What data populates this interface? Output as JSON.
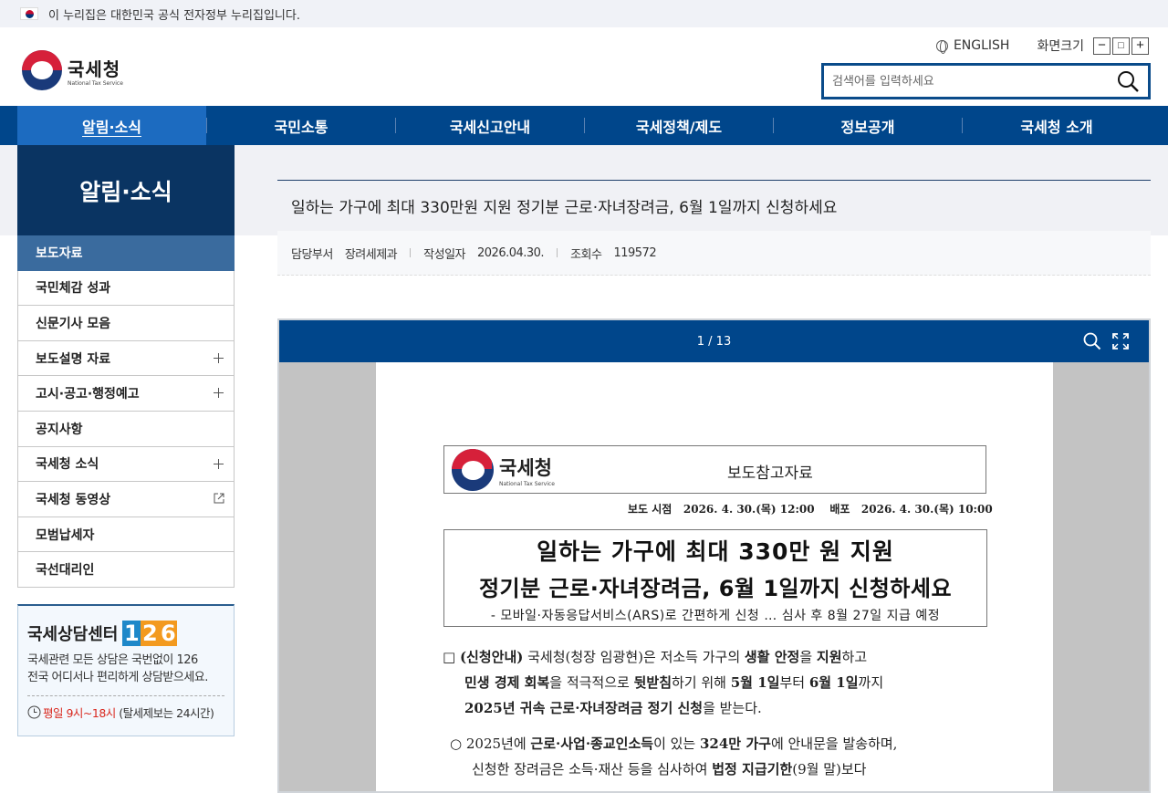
{
  "gov_banner": {
    "text": "이 누리집은 대한민국 공식 전자정부 누리집입니다."
  },
  "logo": {
    "ko": "국세청",
    "en": "National Tax Service"
  },
  "util": {
    "english": "ENGLISH",
    "font_size_label": "화면크기",
    "minus": "−",
    "reset": "□",
    "plus": "+"
  },
  "search": {
    "placeholder": "검색어를 입력하세요"
  },
  "gnb": {
    "items": [
      "알림·소식",
      "국민소통",
      "국세신고안내",
      "국세정책/제도",
      "정보공개",
      "국세청 소개"
    ]
  },
  "sidebar": {
    "title": "알림·소식",
    "items": [
      "보도자료",
      "국민체감 성과",
      "신문기사 모음",
      "보도설명 자료",
      "고시·공고·행정예고",
      "공지사항",
      "국세청 소식",
      "국세청 동영상",
      "모범납세자",
      "국선대리인"
    ]
  },
  "consult": {
    "title": "국세상담센터",
    "number": [
      "1",
      "2",
      "6"
    ],
    "desc1": "국세관련 모든 상담은 국번없이 126",
    "desc2": "전국 어디서나 편리하게 상담받으세요.",
    "hours_red": "평일 9시~18시",
    "hours_rest": "(탈세제보는 24시간)"
  },
  "article": {
    "title": "일하는 가구에 최대 330만원 지원 정기분 근로·자녀장려금, 6월 1일까지 신청하세요",
    "dept_label": "담당부서",
    "dept": "장려세제과",
    "date_label": "작성일자",
    "date": "2026.04.30.",
    "views_label": "조회수",
    "views": "119572"
  },
  "viewer": {
    "page_indicator": "1 / 13"
  },
  "doc": {
    "logo_ko": "국세청",
    "logo_en": "National Tax Service",
    "type": "보도참고자료",
    "time": "보도 시점   2026. 4. 30.(목) 12:00    배포   2026. 4. 30.(목) 10:00",
    "title1": "일하는 가구에 최대 330만 원 지원",
    "title2": "정기분 근로·자녀장려금, 6월 1일까지 신청하세요",
    "subtitle": "- 모바일·자동응답서비스(ARS)로 간편하게 신청 … 심사 후 8월 27일 지급 예정",
    "p1_a": "□ ",
    "p1_b": "(신청안내)",
    "p1_c": " 국세청(청장 임광현)은 저소득 가구의 ",
    "p1_d": "생활 안정",
    "p1_e": "을 ",
    "p1_f": "지원",
    "p1_g": "하고",
    "p1_h": "민생 경제 회복",
    "p1_i": "을 적극적으로 ",
    "p1_j": "뒷받침",
    "p1_k": "하기 위해 ",
    "p1_l": "5월 1일",
    "p1_m": "부터 ",
    "p1_n": "6월 1일",
    "p1_o": "까지",
    "p1_p": "2025년 귀속 근로·자녀장려금 정기 신청",
    "p1_q": "을 받는다.",
    "p2_a": "○ 2025년에 ",
    "p2_b": "근로·사업·종교인소득",
    "p2_c": "이 있는 ",
    "p2_d": "324만 가구",
    "p2_e": "에 안내문을 발송하며,",
    "p2_f": "신청한 장려금은 소득·재산 등을 심사하여 ",
    "p2_g": "법정 지급기한",
    "p2_h": "(9월 말)보다"
  },
  "colors": {
    "nav_blue": "#00468b",
    "nav_active": "#1c6bc0",
    "side_title": "#0a3462",
    "side_active": "#3a6b9e",
    "accent_red": "#d9281e"
  }
}
